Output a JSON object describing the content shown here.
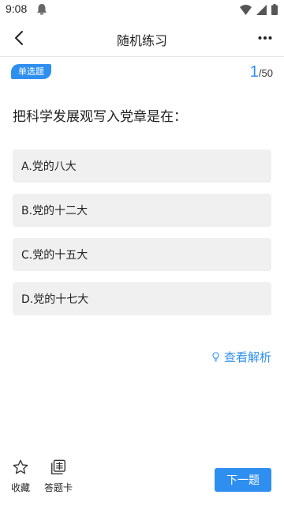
{
  "status_bar": {
    "time": "9:08"
  },
  "header": {
    "title": "随机练习",
    "back_icon": "chevron-left-icon",
    "more_icon": "more-horizontal-icon"
  },
  "quiz": {
    "type_badge": "单选题",
    "progress": {
      "current": "1",
      "separator": "/",
      "total": "50"
    },
    "question": "把科学发展观写入党章是在：",
    "options": [
      {
        "label": "A.党的八大"
      },
      {
        "label": "B.党的十二大"
      },
      {
        "label": "C.党的十五大"
      },
      {
        "label": "D.党的十七大"
      }
    ],
    "analysis_label": "查看解析"
  },
  "bottom": {
    "favorite_label": "收藏",
    "answer_card_label": "答题卡",
    "next_label": "下一题"
  },
  "colors": {
    "accent": "#2f8ff0",
    "option_bg": "#f0f0f0"
  }
}
